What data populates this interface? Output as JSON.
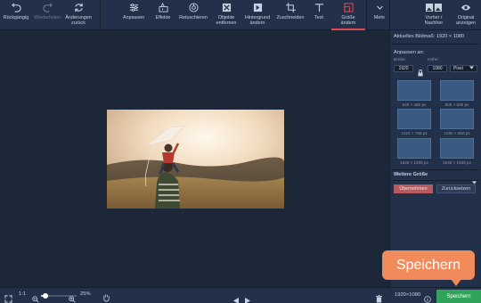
{
  "toolbar": {
    "undo": "Rückgängig",
    "redo": "Wiederholen",
    "discard": "Änderungen\nzurück",
    "adjust": "Anpassen",
    "effects": "Effekte",
    "retouch": "Retuschieren",
    "remove_objects": "Objekte\nentfernen",
    "change_bg": "Hintergrund\nändern",
    "crop": "Zuschneiden",
    "text": "Text",
    "resize": "Größe\nändern",
    "more": "Mehr",
    "before_after": "Vorher /\nNachher",
    "original": "Original\nanzeigen"
  },
  "panel": {
    "current_size_label": "Aktuelles Bildmaß: 1920 × 1080",
    "fit_label": "Anpassen an:",
    "width_label": "Breite:",
    "height_label": "Höhe:",
    "width_value": "1920",
    "height_value": "1080",
    "unit": "Pixel",
    "presets": [
      "640 × 480 px",
      "800 × 600 px",
      "1024 × 768 px",
      "1280 × 960 px",
      "1920 × 1200 px",
      "2048 × 1536 px"
    ],
    "more_sizes": "Weitere Größe",
    "apply": "Übernehmen",
    "reset": "Zurücksetzen"
  },
  "bottom": {
    "fit": "1:1",
    "zoom": "25%",
    "dimensions": "1920×1080",
    "save": "Speichern"
  },
  "callout": {
    "label": "Speichern"
  },
  "colors": {
    "accent": "#e0484f",
    "save": "#2fa45a",
    "callout": "#f28b5c"
  }
}
